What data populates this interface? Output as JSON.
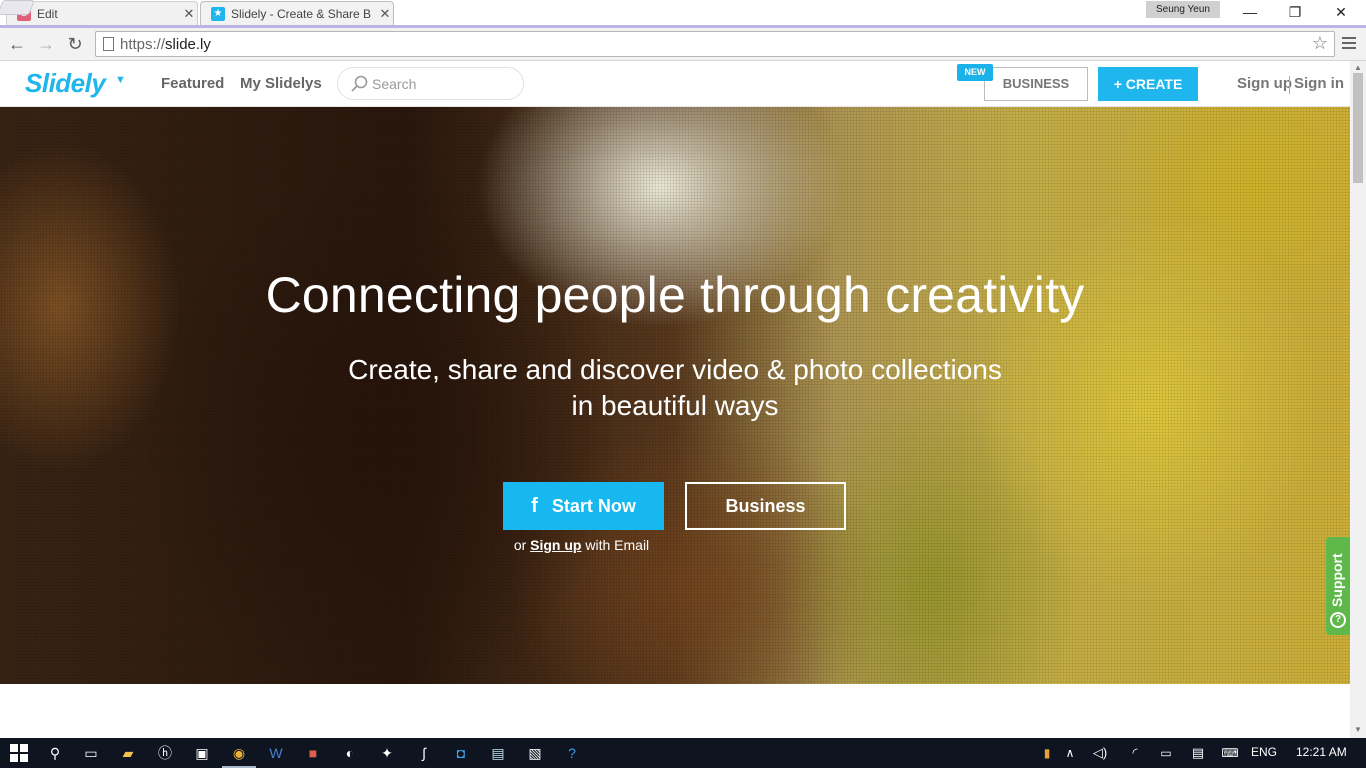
{
  "browser": {
    "tabs": [
      {
        "title": "Edit",
        "favicon_letter": "S",
        "favicon_color": "#e0607a"
      },
      {
        "title": "Slidely - Create & Share B",
        "favicon_color": "#1eb6ec"
      }
    ],
    "profile": "Seung Yeun",
    "window_buttons": {
      "minimize": "—",
      "restore": "❐",
      "close": "✕"
    },
    "url_scheme": "https://",
    "url_host": "slide.ly",
    "nav": {
      "back": "←",
      "forward": "→",
      "reload": "↻"
    }
  },
  "site": {
    "logo": "Slidely",
    "nav": {
      "featured": "Featured",
      "my_slidelys": "My Slidelys"
    },
    "search_placeholder": "Search",
    "new_badge": "NEW",
    "business": "BUSINESS",
    "create": "+ CREATE",
    "sign_up": "Sign up",
    "sign_in": "Sign in",
    "accent_color": "#1eb6ec"
  },
  "hero": {
    "title": "Connecting people through creativity",
    "subtitle_line1": "Create, share and discover video & photo collections",
    "subtitle_line2": "in beautiful ways",
    "start_now": "Start Now",
    "facebook_glyph": "f",
    "business": "Business",
    "or_prefix": "or ",
    "or_link": "Sign up",
    "or_suffix": " with Email"
  },
  "support": {
    "label": "Support",
    "icon": "?",
    "color": "#5fb84a"
  },
  "taskbar": {
    "language": "ENG",
    "time": "12:21 AM",
    "pinned": [
      "start-icon",
      "search-icon",
      "task-view-icon",
      "file-explorer-icon",
      "hp-icon",
      "store-icon",
      "chrome-icon",
      "word-icon",
      "paint-icon",
      "app-icon",
      "app-icon",
      "app-icon",
      "app-icon",
      "notepad-icon",
      "photos-icon",
      "help-icon"
    ]
  }
}
